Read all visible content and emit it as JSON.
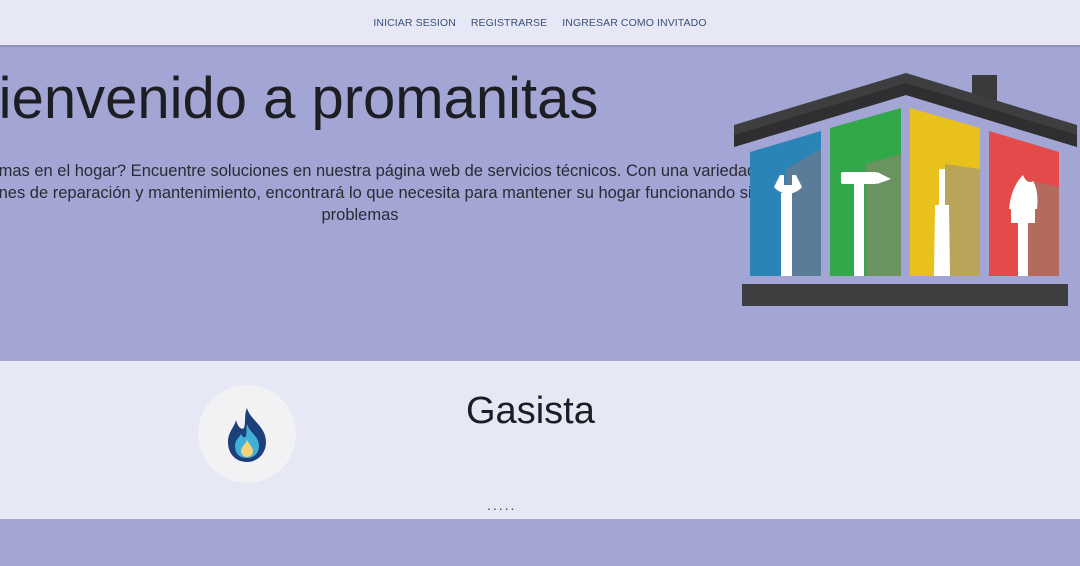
{
  "nav": {
    "login_label": "INICIAR SESION",
    "register_label": "REGISTRARSE",
    "guest_label": "INGRESAR COMO INVITADO"
  },
  "hero": {
    "title": "Bienvenido a promanitas",
    "description": "¿Problemas en el hogar? Encuentre soluciones en nuestra página web de servicios técnicos. Con una variedad de opciones de reparación y mantenimiento, encontrará lo que necesita para mantener su hogar funcionando sin problemas",
    "image_icon": "house-tools-icon"
  },
  "service": {
    "title": "Gasista",
    "icon": "gas-flame-icon",
    "more": "....."
  },
  "colors": {
    "nav_bg": "#e6e8f5",
    "hero_bg": "#a3a6d5",
    "nav_link": "#3a4f78"
  }
}
